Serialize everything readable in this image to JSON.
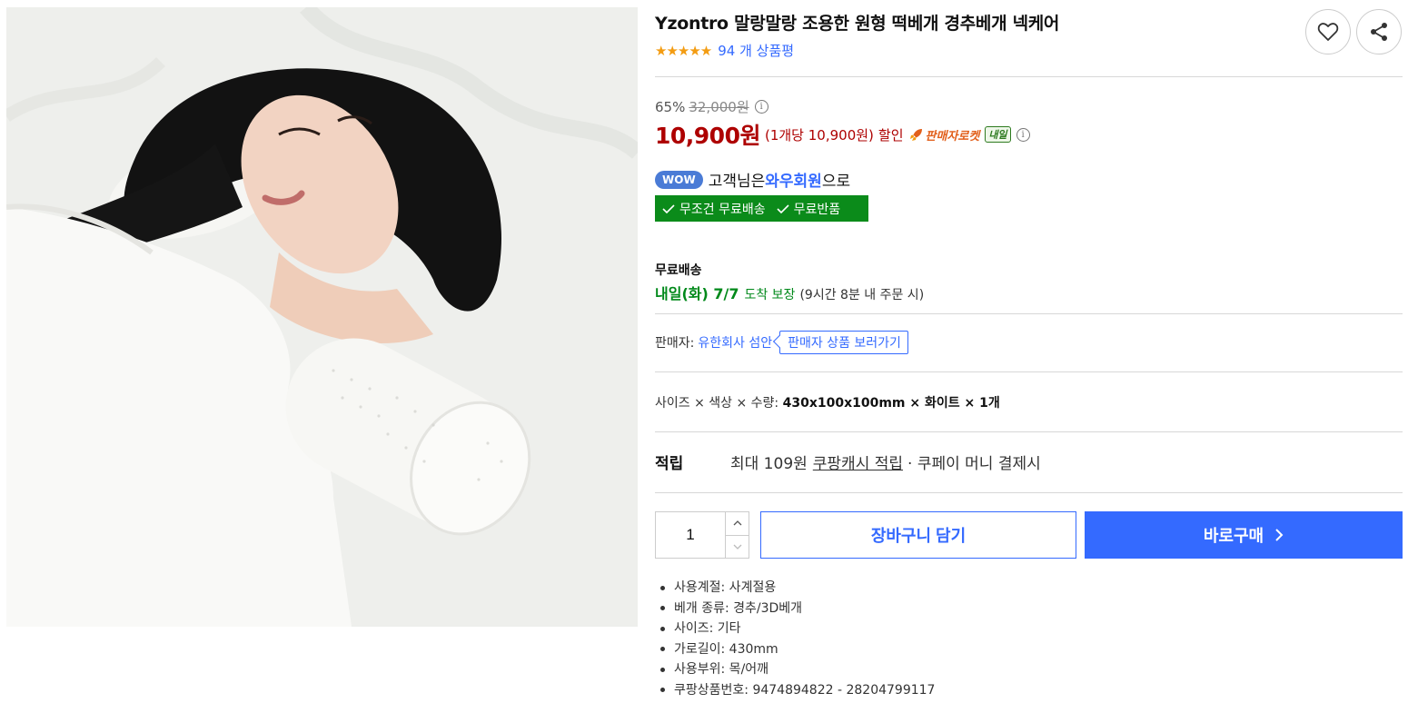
{
  "product": {
    "title": "Yzontro 말랑말랑 조용한 원형 떡베개 경추베개 넥케어",
    "image_alt": "woman sleeping on cylindrical neck pillow",
    "stars": "★★★★★",
    "review_count": "94 개 상품평"
  },
  "pricing": {
    "discount_rate": "65%",
    "original_price": "32,000원",
    "sale_price": "10,900원",
    "unit_price": "(1개당 10,900원)",
    "discount_word": "할인",
    "rocket_label": "판매자로켓",
    "tomorrow_badge": "내일"
  },
  "membership": {
    "wow_badge": "WOW",
    "prefix": "고객님은",
    "highlight": "와우회원",
    "suffix": "으로",
    "benefit_1": "무조건 무료배송",
    "benefit_2": "무료반품"
  },
  "shipping": {
    "title": "무료배송",
    "date": "내일(화) 7/7",
    "guarantee": "도착 보장",
    "note": "(9시간 8분 내 주문 시)"
  },
  "seller": {
    "label": "판매자:",
    "name": "유한회사 섬안",
    "link_label": "판매자 상품 보러가기"
  },
  "option": {
    "label": "사이즈 × 색상 × 수량:",
    "value": "430x100x100mm × 화이트 × 1개"
  },
  "reward": {
    "label": "적립",
    "text": "최대 109원",
    "link": "쿠팡캐시 적립",
    "extra": "· 쿠페이 머니 결제시"
  },
  "purchase": {
    "quantity": "1",
    "cart_label": "장바구니 담기",
    "buy_label": "바로구매"
  },
  "specs": [
    "사용계절: 사계절용",
    "베개 종류: 경추/3D베개",
    "사이즈: 기타",
    "가로길이: 430mm",
    "사용부위: 목/어깨",
    "쿠팡상품번호: 9474894822 - 28204799117"
  ],
  "colors": {
    "price_red": "#ae0000",
    "link_blue": "#346aff",
    "delivery_green": "#00891a",
    "free_bar_green": "#0b8b1a",
    "star_orange": "#f39c12"
  }
}
